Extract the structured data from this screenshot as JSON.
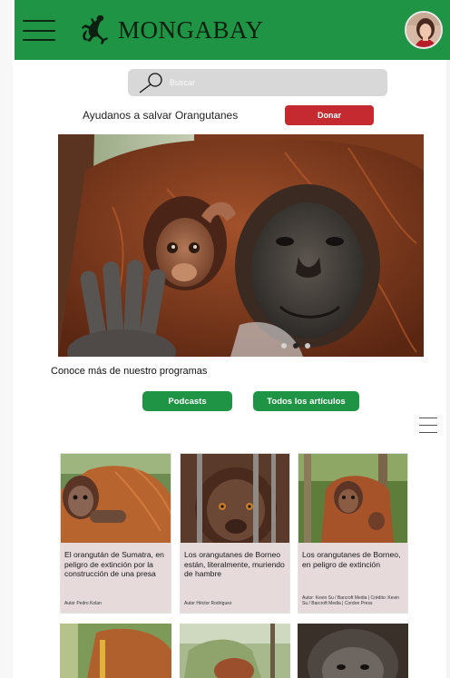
{
  "header": {
    "brand": "MONGABAY",
    "menu_icon": "hamburger-menu-icon",
    "brand_color": "#1e9444"
  },
  "search": {
    "placeholder": "Buscar",
    "value": ""
  },
  "donate": {
    "text": "Ayudanos a salvar Orangutanes",
    "button_label": "Donar",
    "button_color": "#c52a31"
  },
  "carousel": {
    "slide_count": 3,
    "active_slide": 2
  },
  "programs": {
    "text": "Conoce más de nuestro programas",
    "buttons": [
      {
        "label": "Podcasts"
      },
      {
        "label": "Todos los artículos"
      }
    ]
  },
  "articles": [
    {
      "title": "El orangután de Sumatra, en peligro de extinción por la construcción de una presa",
      "author": "Autor Pedro Kolan"
    },
    {
      "title": "Los orangutanes de Borneo están, literalmente, muriendo de hambre",
      "author": "Autor Héctor Rodríguez"
    },
    {
      "title": "Los orangutanes de Borneo, en peligro de extinción",
      "author": "Autor: Kevin Su / Barcroft Media | Crédito: Kevin Su / Barcroft Media | Cordon Press"
    }
  ]
}
